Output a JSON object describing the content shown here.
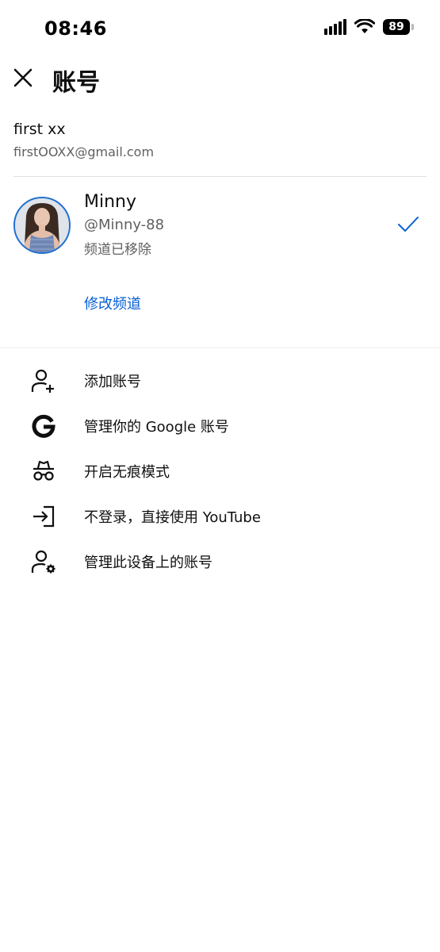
{
  "status_bar": {
    "time": "08:46",
    "battery": "89"
  },
  "header": {
    "title": "账号",
    "close_icon": "close-icon"
  },
  "google_account": {
    "name": "first xx",
    "email": "firstOOXX@gmail.com"
  },
  "channel": {
    "name": "Minny",
    "handle": "@Minny-88",
    "status": "频道已移除",
    "selected": true,
    "check_color": "#065fd4"
  },
  "edit_channel_label": "修改频道",
  "menu": {
    "items": [
      {
        "label": "添加账号",
        "icon": "person-add-icon"
      },
      {
        "label": "管理你的 Google 账号",
        "icon": "google-icon"
      },
      {
        "label": "开启无痕模式",
        "icon": "incognito-icon"
      },
      {
        "label": "不登录，直接使用 YouTube",
        "icon": "sign-in-icon"
      },
      {
        "label": "管理此设备上的账号",
        "icon": "person-settings-icon"
      }
    ]
  },
  "colors": {
    "accent": "#065fd4",
    "text": "#0f0f0f",
    "secondary": "#606060"
  }
}
